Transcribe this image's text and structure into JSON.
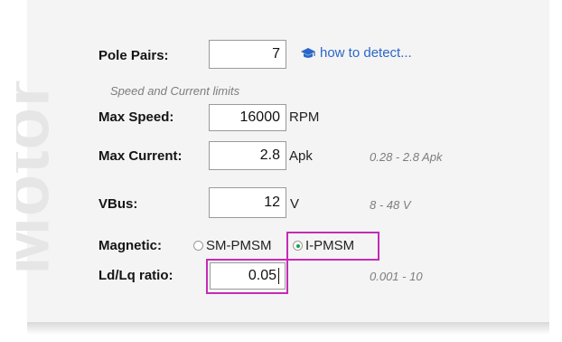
{
  "watermark": "Motor",
  "pole_pairs": {
    "label": "Pole Pairs:",
    "value": "7",
    "link": "how to detect..."
  },
  "limits": {
    "heading": "Speed and Current limits",
    "max_speed": {
      "label": "Max Speed:",
      "value": "16000",
      "unit": "RPM"
    },
    "max_current": {
      "label": "Max Current:",
      "value": "2.8",
      "unit": "Apk",
      "range": "0.28 - 2.8 Apk"
    }
  },
  "vbus": {
    "label": "VBus:",
    "value": "12",
    "unit": "V",
    "range": "8 - 48 V"
  },
  "magnetic": {
    "label": "Magnetic:",
    "options": [
      {
        "label": "SM-PMSM",
        "selected": false
      },
      {
        "label": "I-PMSM",
        "selected": true
      }
    ]
  },
  "ldlq": {
    "label": "Ld/Lq ratio:",
    "value": "0.05",
    "range": "0.001 - 10"
  },
  "colors": {
    "link": "#2a66c8",
    "highlight": "#c52bb6",
    "radio_selected": "#14a34a"
  }
}
